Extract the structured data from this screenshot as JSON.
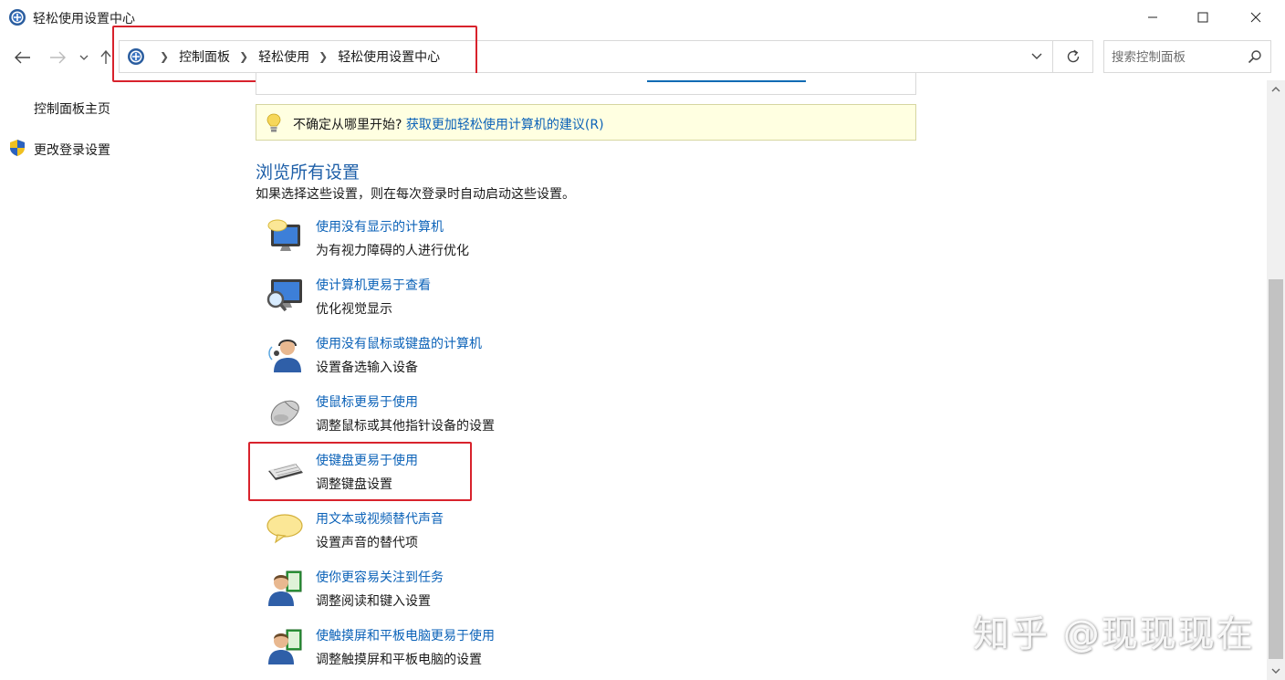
{
  "window": {
    "title": "轻松使用设置中心"
  },
  "address": {
    "breadcrumbs": [
      "控制面板",
      "轻松使用",
      "轻松使用设置中心"
    ],
    "search_placeholder": "搜索控制面板"
  },
  "sidebar": {
    "items": [
      {
        "label": "控制面板主页"
      },
      {
        "label": "更改登录设置"
      }
    ]
  },
  "tip": {
    "prefix": "不确定从哪里开始? ",
    "link": "获取更加轻松使用计算机的建议(R)"
  },
  "section": {
    "title": "浏览所有设置",
    "description": "如果选择这些设置，则在每次登录时自动启动这些设置。"
  },
  "settings": [
    {
      "title": "使用没有显示的计算机",
      "desc": "为有视力障碍的人进行优化",
      "icon": "monitor-speech-icon"
    },
    {
      "title": "使计算机更易于查看",
      "desc": "优化视觉显示",
      "icon": "magnifier-monitor-icon"
    },
    {
      "title": "使用没有鼠标或键盘的计算机",
      "desc": "设置备选输入设备",
      "icon": "headset-user-icon"
    },
    {
      "title": "使鼠标更易于使用",
      "desc": "调整鼠标或其他指针设备的设置",
      "icon": "mouse-icon"
    },
    {
      "title": "使键盘更易于使用",
      "desc": "调整键盘设置",
      "icon": "keyboard-icon"
    },
    {
      "title": "用文本或视频替代声音",
      "desc": "设置声音的替代项",
      "icon": "speech-bubble-icon"
    },
    {
      "title": "使你更容易关注到任务",
      "desc": "调整阅读和键入设置",
      "icon": "user-book-icon"
    },
    {
      "title": "使触摸屏和平板电脑更易于使用",
      "desc": "调整触摸屏和平板电脑的设置",
      "icon": "user-tablet-icon"
    }
  ],
  "watermark": "知乎 @现现现在",
  "colors": {
    "link": "#0b62b8",
    "section_title": "#1e5fa8",
    "tip_background": "#ffffe1",
    "highlight_box": "#d8222c"
  }
}
